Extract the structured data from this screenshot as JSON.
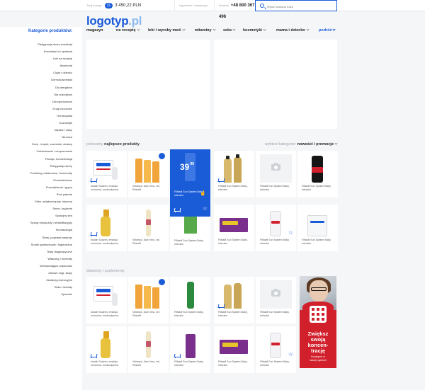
{
  "topbar": {
    "cart_label": "Twój koszyk",
    "cart_count": "31",
    "cart_total": "3 450,22 PLN",
    "login_label": "logowanie / rejestracja",
    "phone_label": "Infolinia",
    "phone_number": "+48 800 367 498",
    "search_placeholder": "Wpisz szukaną frazę"
  },
  "logo": {
    "main": "logotyp",
    "tld": ".pl"
  },
  "sidebar": {
    "title": "Kategorie produktów:",
    "items": [
      "Pielęgnacja skóry wrażliwej",
      "Kosmetyki do opalania",
      "Leki na receptę",
      "Akcesoria",
      "Ciąża i dziecko",
      "Dermokosmetyki",
      "Dla alergików",
      "Dla cukrzyków",
      "Dla sportowców",
      "Drogi moczowe",
      "Homeopatia",
      "Kosmetyki",
      "Męskie i ciasy",
      "Na kaca",
      "Oczy - krople, soczewki, okulary",
      "Odchudzanie i oczyszczanie",
      "Pamięć, koncentracja",
      "Pielęgnacja skóry",
      "Problemy pokarmowe, hemoroidy",
      "Przeciwbólowe",
      "Przeziębienie i grypa",
      "Rzut palenie",
      "Seks, antykoncepcja, intymna",
      "Serce, krążenie",
      "Spokojny sen",
      "Sprzęt medyczny i rehabilitacyjny",
      "Stomatologia",
      "Stres, poprawa nastroju",
      "Środki opatrunkowe i higieniczne",
      "Testy diagnostyczne",
      "Witaminy i minerały",
      "Wzmacniające odporność",
      "Zdrowe nogi, stopy",
      "Zestawy promocyjne",
      "Zioła i herbaty",
      "Zywność"
    ]
  },
  "nav": [
    {
      "label": "magazyn",
      "chevron": false
    },
    {
      "label": "na receptę",
      "chevron": true
    },
    {
      "label": "leki i wyroby med.",
      "chevron": true
    },
    {
      "label": "witaminy",
      "chevron": true
    },
    {
      "label": "seks",
      "chevron": true
    },
    {
      "label": "kosmetyki",
      "chevron": true
    },
    {
      "label": "mama i dziecko",
      "chevron": true
    },
    {
      "label": "podróż",
      "chevron": true
    }
  ],
  "section1": {
    "title_light": "polecamy",
    "title_bold": "najlepsze produkty",
    "filter_label": "wybierz kategorie:",
    "filter_value": "nowości i promocje"
  },
  "section2": {
    "title": "witaminy i suplementy"
  },
  "products": {
    "acatar": "Iwadin Solarim, emulsja ochronna, wodoodporna",
    "aloe": "Viridepol, Aloe Vera, żel, Relaxfit",
    "filrstil": "Filfastil Sun System Baby, mleczko",
    "price_int": "39",
    "price_dec": "99"
  },
  "ad": {
    "headline_1": "Zwiększ",
    "headline_2": "swoją",
    "headline_3": "koncen-",
    "headline_4": "trację",
    "sub_1": "Dostępne w",
    "sub_2": "naszej aptece!"
  },
  "colors": {
    "accent": "#1a5bd8",
    "ad_red": "#d21f2c",
    "background": "#f5f6f8"
  }
}
